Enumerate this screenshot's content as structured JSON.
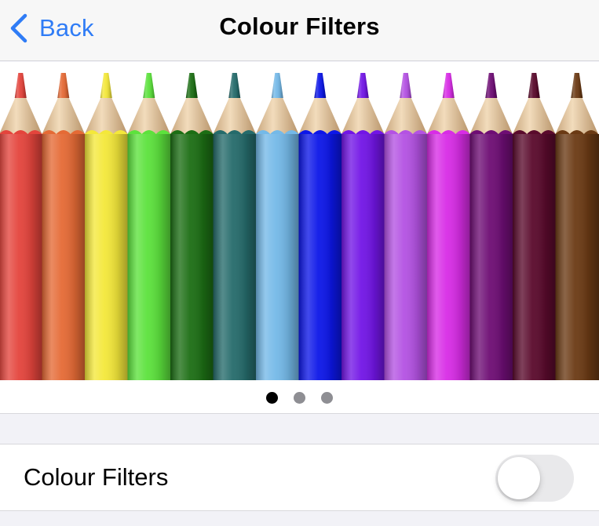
{
  "navbar": {
    "back_label": "Back",
    "title": "Colour Filters",
    "back_icon": "chevron-left-icon",
    "accent_color": "#2f7cf6"
  },
  "preview": {
    "image_subject": "colored pencils",
    "pencil_colors": [
      "#e4443c",
      "#e56a35",
      "#f4e83a",
      "#5ce23c",
      "#1c6e14",
      "#256b6b",
      "#74b9e8",
      "#0c16e8",
      "#7215e6",
      "#b452e3",
      "#d82ce6",
      "#6e0d74",
      "#5a0a2c",
      "#6b3a14"
    ],
    "page_dots": {
      "count": 3,
      "active_index": 0
    }
  },
  "settings": {
    "colour_filters": {
      "label": "Colour Filters",
      "enabled": false
    }
  }
}
